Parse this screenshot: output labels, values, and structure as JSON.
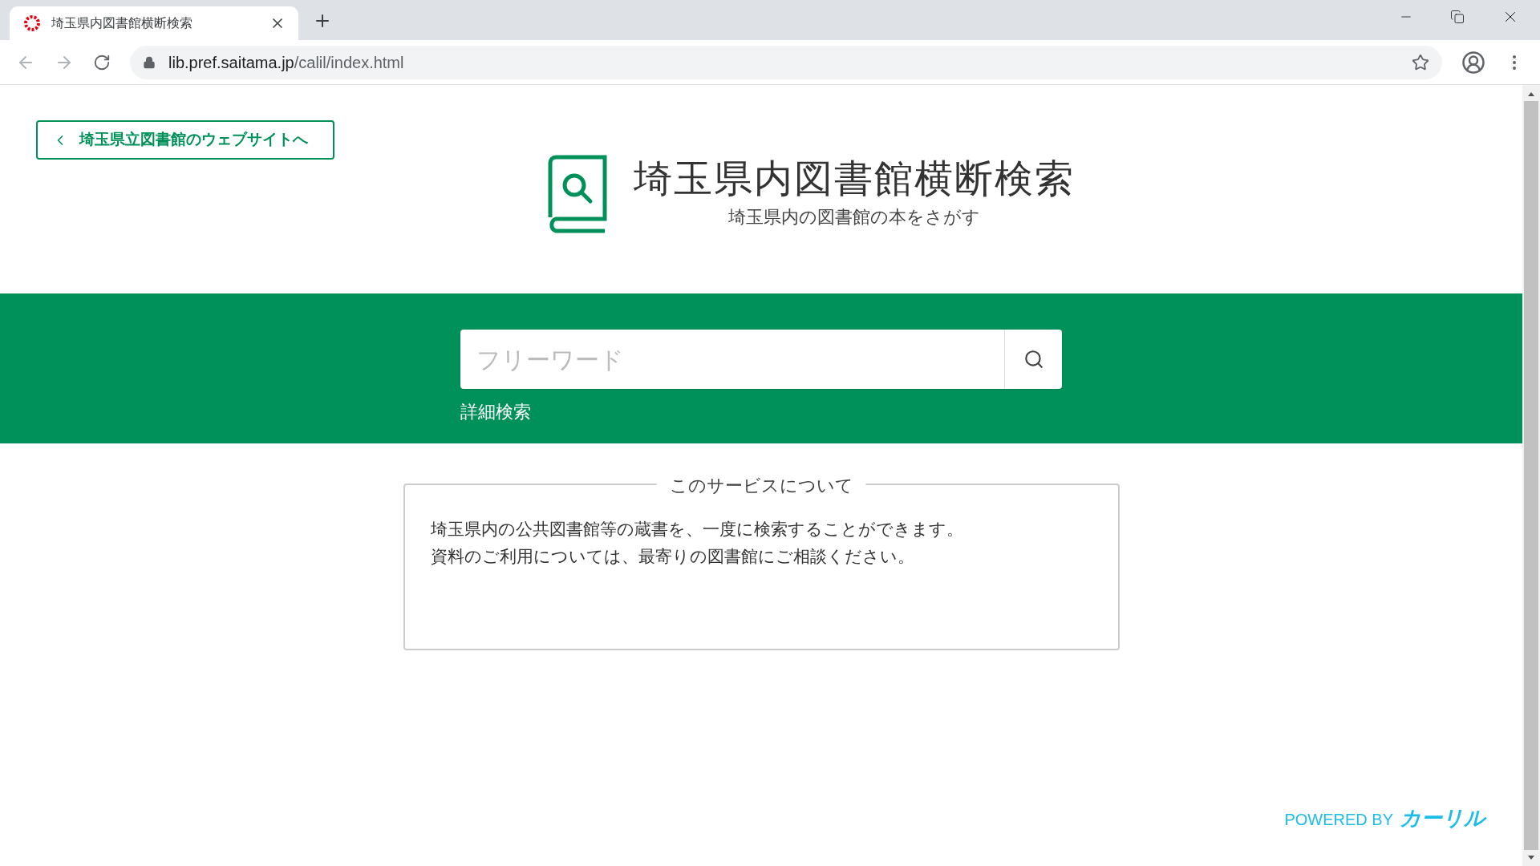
{
  "browser": {
    "tab": {
      "title": "埼玉県内図書館横断検索"
    },
    "url": {
      "host": "lib.pref.saitama.jp",
      "path": "/calil/index.html"
    }
  },
  "header": {
    "back_link": "埼玉県立図書館のウェブサイトへ",
    "title": "埼玉県内図書館横断検索",
    "subtitle": "埼玉県内の図書館の本をさがす"
  },
  "search": {
    "placeholder": "フリーワード",
    "advanced_link": "詳細検索"
  },
  "about": {
    "legend": "このサービスについて",
    "lines": [
      "埼玉県内の公共図書館等の蔵書を、一度に検索することができます。",
      "資料のご利用については、最寄りの図書館にご相談ください。"
    ]
  },
  "footer": {
    "powered_by": "POWERED BY",
    "brand": "カーリル"
  }
}
